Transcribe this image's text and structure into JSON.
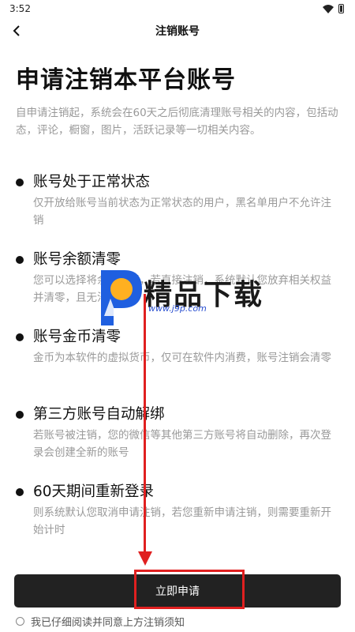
{
  "status_bar": {
    "time": "3:52"
  },
  "nav": {
    "title": "注销账号"
  },
  "page_title": "申请注销本平台账号",
  "intro": "自申请注销起，系统会在60天之后彻底清理账号相关的内容，包括动态，评论，橱窗，图片，活跃记录等一切相关内容。",
  "items": [
    {
      "heading": "账号处于正常状态",
      "desc": "仅开放给账号当前状态为正常状态的用户，黑名单用户不允许注销"
    },
    {
      "heading": "账号余额清零",
      "desc": "您可以选择将余额提现，若直接注销，系统默认您放弃相关权益并清零，且无法恢复"
    },
    {
      "heading": "账号金币清零",
      "desc": "金币为本软件的虚拟货币，仅可在软件内消费，账号注销会清零"
    },
    {
      "heading": "第三方账号自动解绑",
      "desc": "若账号被注销，您的微信等其他第三方账号将自动删除，再次登录会创建全新的账号"
    },
    {
      "heading": "60天期间重新登录",
      "desc": "则系统默认您取消申请注销，若您重新申请注销，则需要重新开始计时"
    }
  ],
  "watermark": {
    "text": "精品下载",
    "sub": "www.j9p.com"
  },
  "submit_label": "立即申请",
  "agree_label": "我已仔细阅读并同意上方注销须知",
  "colors": {
    "accent": "#e02020",
    "button": "#222222",
    "muted": "#999999"
  }
}
